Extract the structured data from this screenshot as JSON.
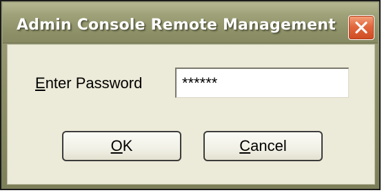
{
  "window": {
    "title": "Admin Console Remote Management",
    "close_icon": "close-icon"
  },
  "password": {
    "label_mnemonic": "E",
    "label_rest": "nter Password",
    "value": "******"
  },
  "buttons": {
    "ok_mnemonic": "O",
    "ok_rest": "K",
    "cancel_mnemonic": "C",
    "cancel_rest": "ancel"
  },
  "colors": {
    "titlebar": "#9fa279",
    "close_button": "#e2683e",
    "client_background": "#ecead8"
  }
}
